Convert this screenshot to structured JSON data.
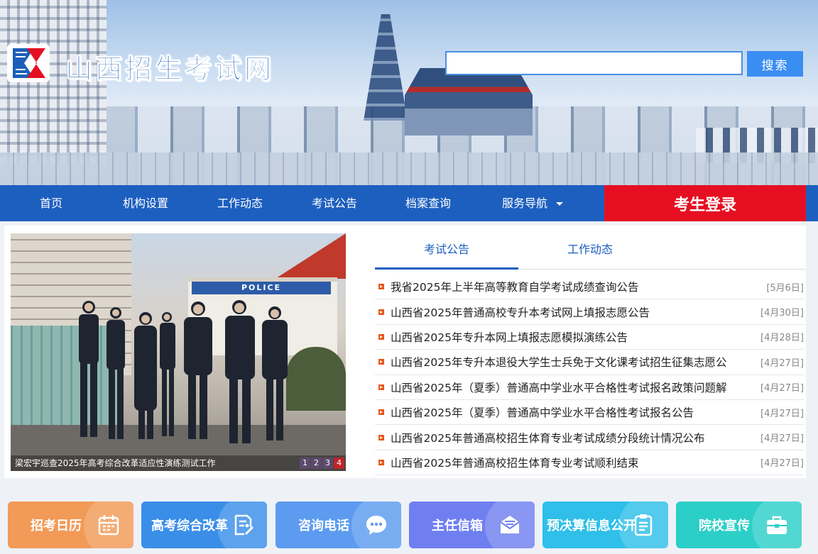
{
  "header": {
    "site_title": "山西招生考试网",
    "search_placeholder": "",
    "search_button": "搜索"
  },
  "nav": {
    "items": [
      {
        "label": "首页"
      },
      {
        "label": "机构设置"
      },
      {
        "label": "工作动态"
      },
      {
        "label": "考试公告"
      },
      {
        "label": "档案查询"
      },
      {
        "label": "服务导航"
      }
    ],
    "login_label": "考生登录"
  },
  "slideshow": {
    "caption": "梁宏宇巡查2025年高考综合改革适应性演练测试工作",
    "police_sign": "POLICE",
    "pages": [
      "1",
      "2",
      "3",
      "4"
    ],
    "active_page": "4"
  },
  "tabs": [
    {
      "label": "考试公告",
      "active": true
    },
    {
      "label": "工作动态",
      "active": false
    }
  ],
  "news": [
    {
      "title": "我省2025年上半年高等教育自学考试成绩查询公告",
      "date": "[5月6日]"
    },
    {
      "title": "山西省2025年普通高校专升本考试网上填报志愿公告",
      "date": "[4月30日]"
    },
    {
      "title": "山西省2025年专升本网上填报志愿模拟演练公告",
      "date": "[4月28日]"
    },
    {
      "title": "山西省2025年专升本退役大学生士兵免于文化课考试招生征集志愿公",
      "date": "[4月27日]"
    },
    {
      "title": "山西省2025年（夏季）普通高中学业水平合格性考试报名政策问题解",
      "date": "[4月27日]"
    },
    {
      "title": "山西省2025年（夏季）普通高中学业水平合格性考试报名公告",
      "date": "[4月27日]"
    },
    {
      "title": "山西省2025年普通高校招生体育专业考试成绩分段统计情况公布",
      "date": "[4月27日]"
    },
    {
      "title": "山西省2025年普通高校招生体育专业考试顺利结束",
      "date": "[4月27日]"
    }
  ],
  "quick_links": [
    {
      "label": "招考日历",
      "icon": "calendar-icon",
      "color": "#f29a57"
    },
    {
      "label": "高考综合改革",
      "icon": "document-edit-icon",
      "color": "#3a8ee8"
    },
    {
      "label": "咨询电话",
      "icon": "chat-bubble-icon",
      "color": "#5c9bf0"
    },
    {
      "label": "主任信箱",
      "icon": "mail-icon",
      "color": "#6f7ff0"
    },
    {
      "label": "预决算信息公开",
      "icon": "clipboard-icon",
      "color": "#2fbfe8"
    },
    {
      "label": "院校宣传",
      "icon": "briefcase-icon",
      "color": "#2ccfc8"
    }
  ],
  "colors": {
    "nav_blue": "#1d5fbf",
    "login_red": "#e60f22",
    "bullet_orange": "#e8551c"
  }
}
